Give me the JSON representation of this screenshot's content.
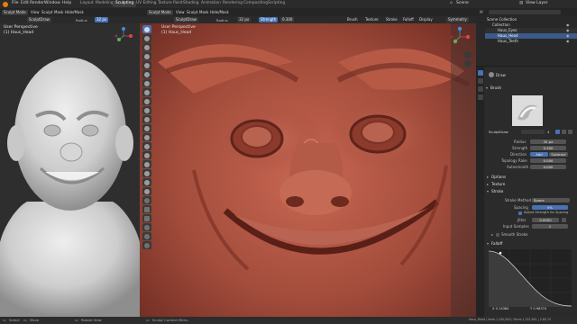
{
  "topbar": {
    "menus": [
      "File",
      "Edit",
      "Render",
      "Window",
      "Help"
    ],
    "workspaces": [
      "Layout",
      "Modeling",
      "Sculpting",
      "UV Editing",
      "Texture Paint",
      "Shading",
      "Animation",
      "Rendering",
      "Compositing",
      "Scripting"
    ],
    "active_workspace": "Sculpting",
    "scene": "Scene",
    "view_layer": "View Layer"
  },
  "left_view": {
    "header": [
      "Sculpt Mode",
      "View",
      "Sculpt",
      "Mask",
      "Hide/Mask"
    ],
    "brush_name": "SculptDraw",
    "radius_label": "Radius",
    "radius_value": "32 px",
    "perspective": "User Perspective",
    "object": "(1) Haus_Head"
  },
  "main_view": {
    "header": [
      "Sculpt Mode",
      "View",
      "Sculpt",
      "Mask",
      "Hide/Mask"
    ],
    "brush_name": "SculptDraw",
    "radius_label": "Radius",
    "radius_value": "32 px",
    "strength_label": "Strength",
    "strength_value": "0.300",
    "header_right": [
      "Brush",
      "Texture",
      "Stroke",
      "Falloff",
      "Display"
    ],
    "symmetry_label": "Symmetry",
    "perspective": "User Perspective",
    "object": "(1) Haus_Head"
  },
  "outliner": {
    "title": "Scene Collection",
    "items": [
      "Collection",
      "Haus_Eyes",
      "Haus_Head",
      "Haus_Teeth"
    ]
  },
  "properties": {
    "brush_slot": "Draw",
    "brush_section": "Brush",
    "brush_datablock": "SculptDraw",
    "brush_users": "4",
    "fields": [
      {
        "label": "Radius",
        "value": "32 px"
      },
      {
        "label": "Strength",
        "value": "0.300"
      },
      {
        "label": "Direction",
        "value": "Add"
      },
      {
        "label": "Topology Rake",
        "value": "0.000"
      },
      {
        "label": "Autosmooth",
        "value": "0.000"
      }
    ],
    "direction_alt": "Subtract",
    "sections": [
      "Options",
      "Texture",
      "Stroke"
    ],
    "stroke_method_label": "Stroke Method",
    "stroke_method_value": "Space",
    "spacing_label": "Spacing",
    "spacing_value": "5%",
    "adjust_label": "Adjust Strength for Spacing",
    "jitter_label": "Jitter",
    "jitter_value": "0.0000",
    "input_samples_label": "Input Samples",
    "input_samples_value": "1",
    "smooth_stroke_label": "Smooth Stroke",
    "falloff_label": "Falloff",
    "curve_x": "X 0.14384",
    "curve_y": "Y 0.96374"
  },
  "status": {
    "left": "Select",
    "mid": "Move",
    "rotate": "Rotate View",
    "context": "Sculpt Context Menu",
    "stats": "Haus_Head | Verts 1,200,643 | Faces 1,197,461 | 2.80.74"
  },
  "colors": {
    "accent": "#4772b3",
    "skin": "#9b4a3a",
    "clay": "#d9d9d9"
  }
}
